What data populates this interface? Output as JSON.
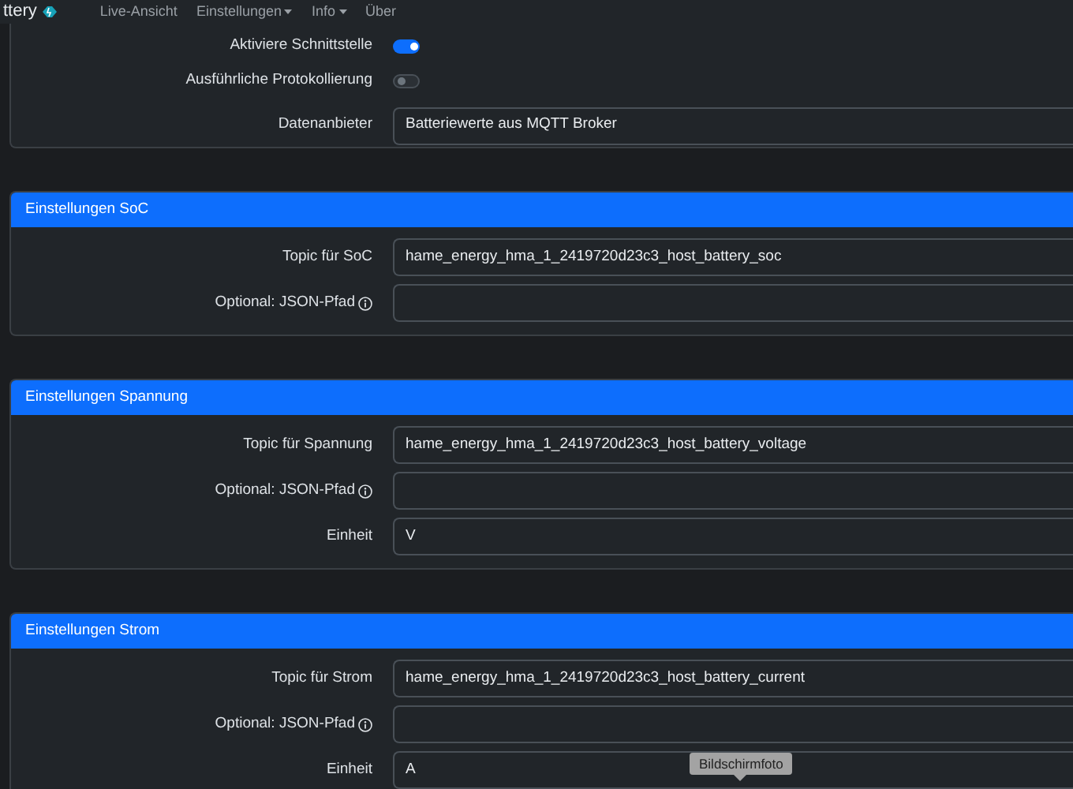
{
  "navbar": {
    "brand": "ttery",
    "items": [
      {
        "label": "Live-Ansicht",
        "dropdown": false
      },
      {
        "label": "Einstellungen",
        "dropdown": true
      },
      {
        "label": "Info",
        "dropdown": true
      },
      {
        "label": "Über",
        "dropdown": false
      }
    ]
  },
  "general": {
    "rows": [
      {
        "kind": "switch",
        "label": "Aktiviere Schnittstelle",
        "on": true
      },
      {
        "kind": "switch",
        "label": "Ausführliche Protokollierung",
        "on": false
      },
      {
        "kind": "select",
        "label": "Datenanbieter",
        "value": "Batteriewerte aus MQTT Broker"
      }
    ]
  },
  "sections": [
    {
      "title": "Einstellungen SoC",
      "rows": [
        {
          "label": "Topic für SoC",
          "value": "hame_energy_hma_1_2419720d23c3_host_battery_soc",
          "info": false
        },
        {
          "label": "Optional: JSON-Pfad",
          "info": true
        }
      ]
    },
    {
      "title": "Einstellungen Spannung",
      "rows": [
        {
          "label": "Topic für Spannung",
          "value": "hame_energy_hma_1_2419720d23c3_host_battery_voltage",
          "info": false
        },
        {
          "label": "Optional: JSON-Pfad",
          "info": true
        },
        {
          "label": "Einheit",
          "value": "V",
          "info": false
        }
      ]
    },
    {
      "title": "Einstellungen Strom",
      "rows": [
        {
          "label": "Topic für Strom",
          "value": "hame_energy_hma_1_2419720d23c3_host_battery_current",
          "info": false
        },
        {
          "label": "Optional: JSON-Pfad",
          "info": true
        },
        {
          "label": "Einheit",
          "value": "A",
          "info": false
        }
      ]
    }
  ],
  "tooltip": "Bildschirmfoto"
}
